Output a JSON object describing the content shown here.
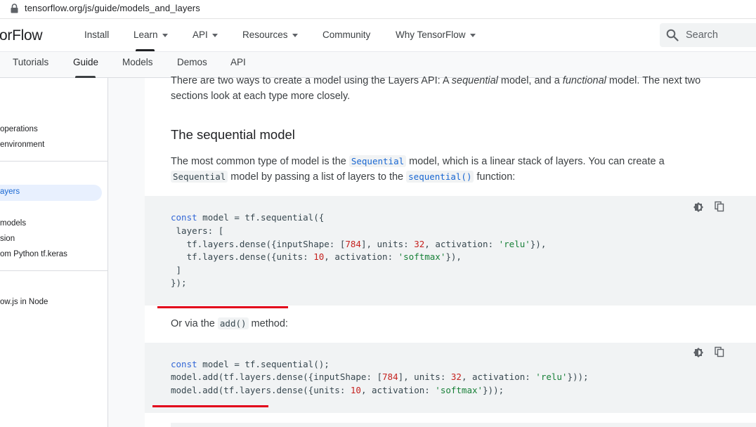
{
  "browser": {
    "url": "tensorflow.org/js/guide/models_and_layers"
  },
  "topnav": {
    "brand": "orFlow",
    "items": [
      {
        "label": "Install",
        "dropdown": false
      },
      {
        "label": "Learn",
        "dropdown": true
      },
      {
        "label": "API",
        "dropdown": true
      },
      {
        "label": "Resources",
        "dropdown": true
      },
      {
        "label": "Community",
        "dropdown": false
      },
      {
        "label": "Why TensorFlow",
        "dropdown": true
      }
    ],
    "search_label": "Search"
  },
  "subnav": {
    "items": [
      "Tutorials",
      "Guide",
      "Models",
      "Demos",
      "API"
    ],
    "active": "Guide"
  },
  "sidebar": {
    "items": [
      {
        "label": "operations",
        "active": false
      },
      {
        "label": "environment",
        "active": false
      },
      {
        "label": "ayers",
        "active": true
      },
      {
        "label": " models",
        "active": false
      },
      {
        "label": "sion",
        "active": false
      },
      {
        "label": "om Python tf.keras",
        "active": false
      },
      {
        "label": "ow.js in Node",
        "active": false
      }
    ]
  },
  "main": {
    "intro": {
      "line1_a": "There are two ways to create a model using the Layers API: A ",
      "line1_em1": "sequential",
      "line1_b": " model, and a ",
      "line1_em2": "functional",
      "line1_c": " model. The next two",
      "line2": "sections look at each type more closely."
    },
    "heading": "The sequential model",
    "para2": {
      "line1_a": "The most common type of model is the ",
      "line1_code": "Sequential",
      "line1_b": " model, which is a linear stack of layers. You can create a",
      "line2_code1": "Sequential",
      "line2_a": " model by passing a list of layers to the ",
      "line2_code2": "sequential()",
      "line2_b": " function:"
    },
    "code1": [
      "const model = tf.sequential({",
      " layers: [",
      "   tf.layers.dense({inputShape: [784], units: 32, activation: 'relu'}),",
      "   tf.layers.dense({units: 10, activation: 'softmax'}),",
      " ]",
      "});"
    ],
    "para3": {
      "a": "Or via the ",
      "code": "add()",
      "b": " method:"
    },
    "code2": [
      "const model = tf.sequential();",
      "model.add(tf.layers.dense({inputShape: [784], units: 32, activation: 'relu'}));",
      "model.add(tf.layers.dense({units: 10, activation: 'softmax'}));"
    ]
  },
  "colors": {
    "link": "#1967d2",
    "red_annotation": "#e2001a",
    "code_bg": "#f1f3f4"
  }
}
